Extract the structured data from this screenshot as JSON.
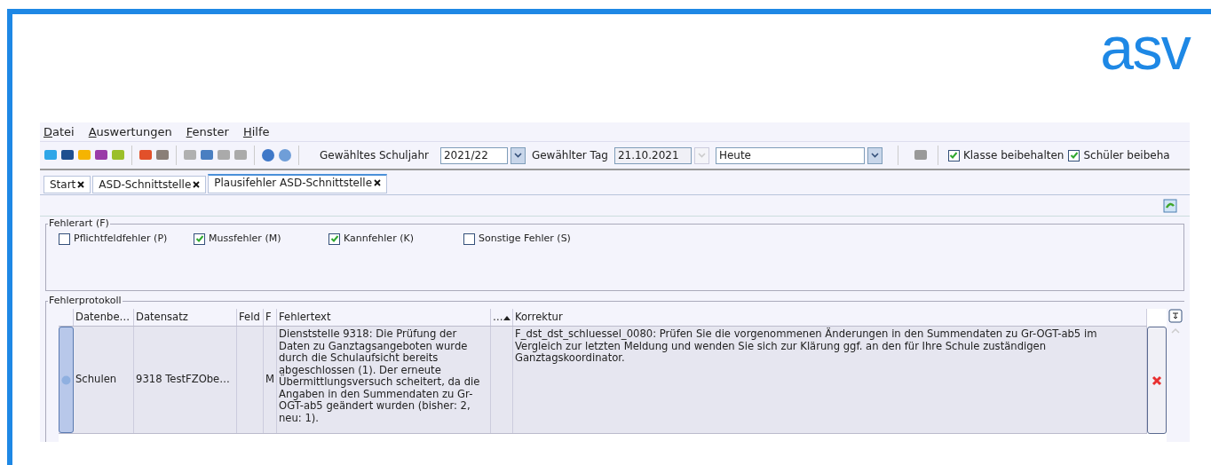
{
  "logo": {
    "text": "asv"
  },
  "menu": [
    "Datei",
    "Auswertungen",
    "Fenster",
    "Hilfe"
  ],
  "toolbar": {
    "schuljahr_label": "Gewähltes Schuljahr",
    "schuljahr_value": "2021/22",
    "tag_label": "Gewählter Tag",
    "tag_value": "21.10.2021",
    "tag_disabled": true,
    "period_value": "Heute",
    "checkboxes": [
      {
        "label": "Klasse beibehalten",
        "checked": true
      },
      {
        "label": "Schüler beibeha",
        "checked": true
      }
    ]
  },
  "tabs": [
    {
      "label": "Start",
      "selected": false
    },
    {
      "label": "ASD-Schnittstelle",
      "selected": false
    },
    {
      "label": "Plausifehler ASD-Schnittstelle",
      "selected": true
    }
  ],
  "fehlerart": {
    "title": "Fehlerart (F)",
    "options": [
      {
        "label": "Pflichtfeldfehler (P)",
        "checked": false
      },
      {
        "label": "Mussfehler (M)",
        "checked": true
      },
      {
        "label": "Kannfehler (K)",
        "checked": true
      },
      {
        "label": "Sonstige Fehler (S)",
        "checked": false
      }
    ]
  },
  "protokoll": {
    "title": "Fehlerprotokoll",
    "columns": [
      {
        "label": "Datenbe…"
      },
      {
        "label": "Datensatz"
      },
      {
        "label": "Feld"
      },
      {
        "label": "F"
      },
      {
        "label": "Fehlertext"
      },
      {
        "label": "…",
        "sorted_ascending": true
      },
      {
        "label": "Korrektur"
      }
    ],
    "rows": [
      {
        "cells": [
          "Schulen",
          "9318 TestFZObe…",
          "",
          "M",
          "Dienststelle 9318: Die Prüfung der Daten zu Ganztagsangeboten wurde durch die Schulaufsicht bereits abgeschlossen (1). Der erneute Übermittlungsversuch scheitert, da die Angaben in den Summendaten zu Gr-OGT-ab5 geändert wurden (bisher: 2, neu: 1).",
          "",
          "F_dst_dst_schluessel_0080: Prüfen Sie die vorgenommenen Änderungen in den Summendaten zu Gr-OGT-ab5 im Vergleich zur letzten Meldung und wenden Sie sich zur Klärung ggf. an den für Ihre Schule zuständigen Ganztagskoordinator."
        ]
      }
    ]
  }
}
